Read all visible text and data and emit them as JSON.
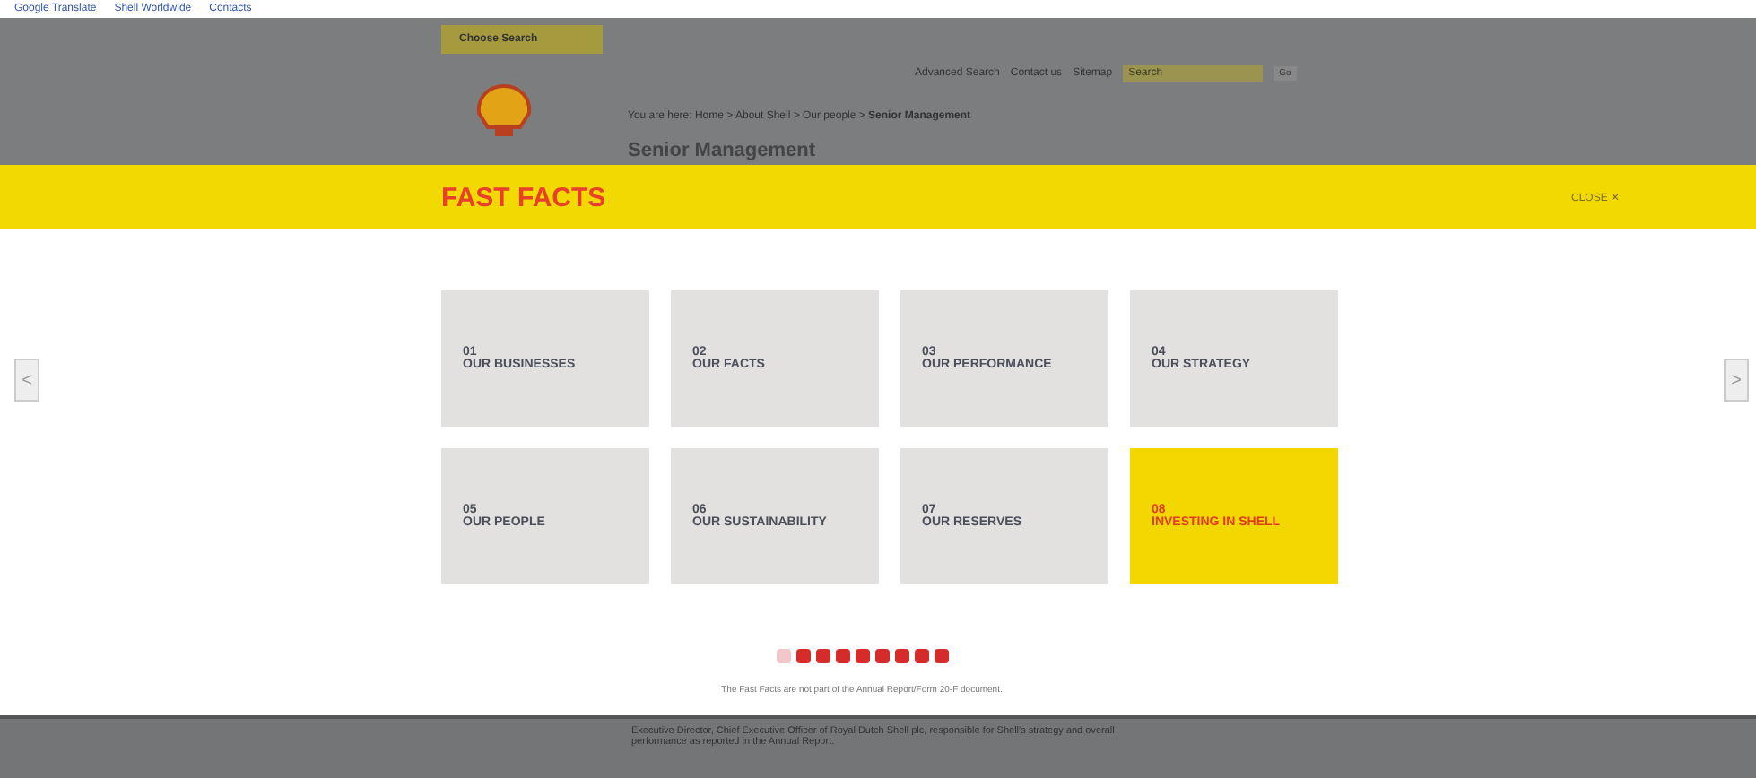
{
  "favorites_bar": [
    "Google Translate",
    "Shell Worldwide",
    "Contacts"
  ],
  "background_page": {
    "location_button": "Choose Search",
    "links": [
      "Advanced Search",
      "Contact us",
      "Sitemap"
    ],
    "search": {
      "placeholder": "Search"
    },
    "search_button": "Go",
    "breadcrumb": "You are here: Home > About Shell > Our people > **Senior Management**",
    "heading": "Senior Management",
    "footer_text": "Executive Director, Chief Executive Officer of Royal Dutch Shell plc, responsible for Shell's strategy and overall performance as reported in the Annual Report."
  },
  "overlay": {
    "title": "FAST FACTS",
    "close": "CLOSE ✕",
    "tiles": [
      {
        "number": "01",
        "label": "OUR BUSINESSES",
        "selected": false
      },
      {
        "number": "02",
        "label": "OUR FACTS",
        "selected": false
      },
      {
        "number": "03",
        "label": "OUR PERFORMANCE",
        "selected": false
      },
      {
        "number": "04",
        "label": "OUR STRATEGY",
        "selected": false
      },
      {
        "number": "05",
        "label": "OUR PEOPLE",
        "selected": false
      },
      {
        "number": "06",
        "label": "OUR SUSTAINABILITY",
        "selected": false
      },
      {
        "number": "07",
        "label": "OUR RESERVES",
        "selected": false
      },
      {
        "number": "08",
        "label": "INVESTING IN SHELL",
        "selected": true
      }
    ],
    "prev": "<",
    "next": ">",
    "dots": [
      {
        "selected": true
      },
      {
        "selected": false
      },
      {
        "selected": false
      },
      {
        "selected": false
      },
      {
        "selected": false
      },
      {
        "selected": false
      },
      {
        "selected": false
      },
      {
        "selected": false
      },
      {
        "selected": false
      }
    ],
    "note": "The Fast Facts are not part of the Annual Report/Form 20-F document."
  }
}
